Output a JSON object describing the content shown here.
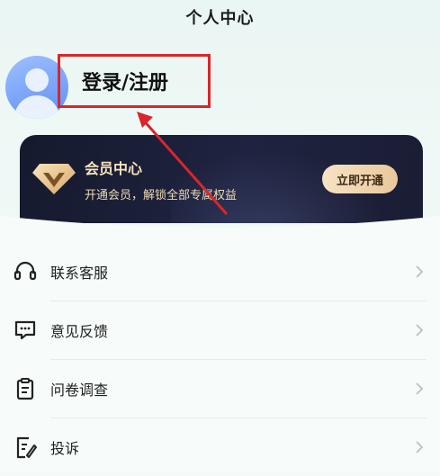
{
  "header": {
    "title": "个人中心"
  },
  "profile": {
    "login_label": "登录/注册"
  },
  "vip": {
    "title": "会员中心",
    "subtitle": "开通会员，解锁全部专属权益",
    "button_label": "立即开通"
  },
  "menu": {
    "items": [
      {
        "label": "联系客服",
        "icon": "headset-icon"
      },
      {
        "label": "意见反馈",
        "icon": "feedback-icon"
      },
      {
        "label": "问卷调查",
        "icon": "clipboard-icon"
      },
      {
        "label": "投诉",
        "icon": "complaint-icon"
      }
    ]
  },
  "colors": {
    "highlight_box": "#d9262b",
    "vip_gold": "#f6e2bd",
    "card_dark": "#151a2e"
  }
}
